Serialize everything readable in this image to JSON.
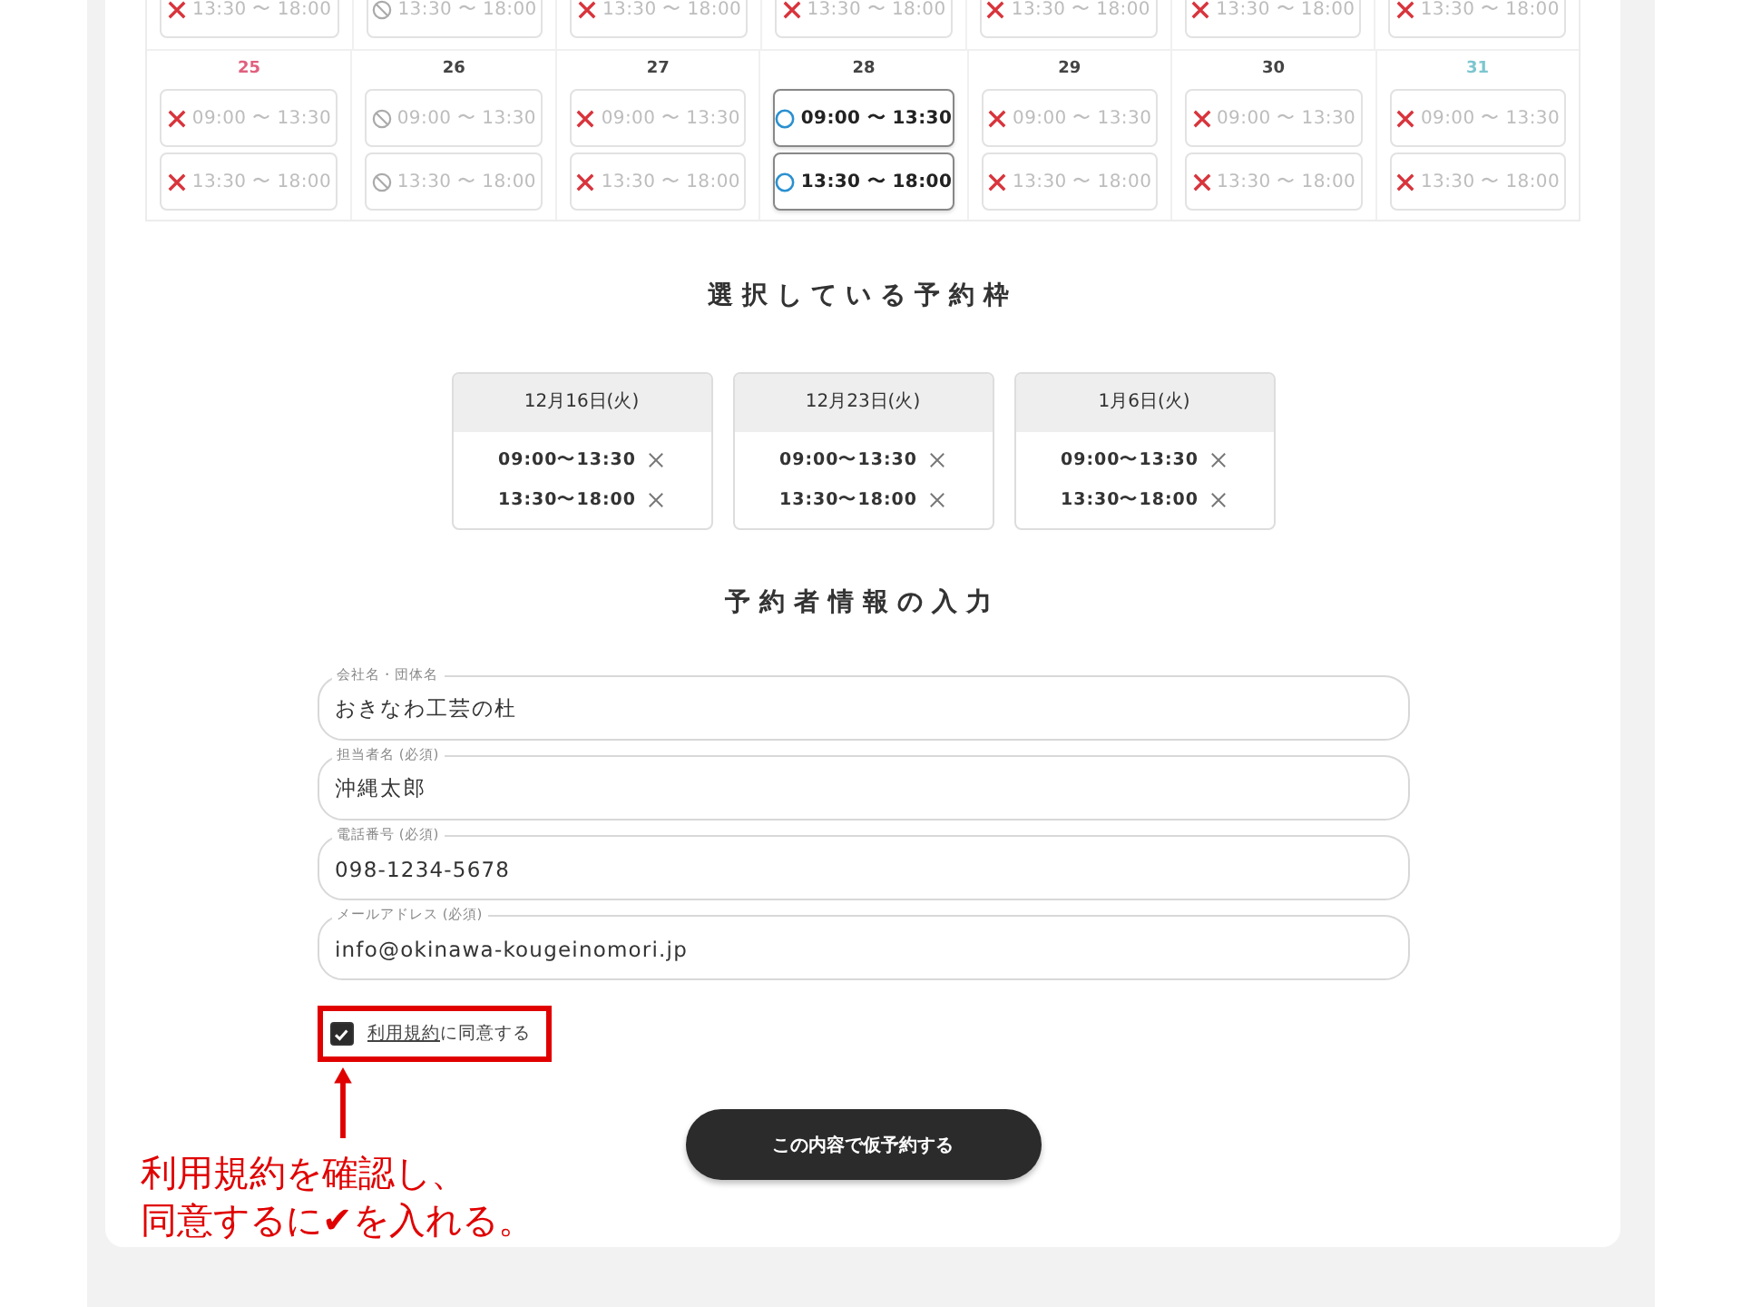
{
  "calendar": {
    "weeks": [
      {
        "days": [
          {
            "slots": [
              {
                "time": "13:30 〜 18:00",
                "kind": "full"
              }
            ]
          },
          {
            "slots": [
              {
                "time": "13:30 〜 18:00",
                "kind": "closed"
              }
            ]
          },
          {
            "slots": [
              {
                "time": "13:30 〜 18:00",
                "kind": "full"
              }
            ]
          },
          {
            "slots": [
              {
                "time": "13:30 〜 18:00",
                "kind": "full"
              }
            ]
          },
          {
            "slots": [
              {
                "time": "13:30 〜 18:00",
                "kind": "full"
              }
            ]
          },
          {
            "slots": [
              {
                "time": "13:30 〜 18:00",
                "kind": "full"
              }
            ]
          },
          {
            "slots": [
              {
                "time": "13:30 〜 18:00",
                "kind": "full"
              }
            ]
          }
        ]
      },
      {
        "days": [
          {
            "date": "25",
            "color": "#e0607e",
            "slots": [
              {
                "time": "09:00 〜 13:30",
                "kind": "full"
              },
              {
                "time": "13:30 〜 18:00",
                "kind": "full"
              }
            ]
          },
          {
            "date": "26",
            "color": "#444444",
            "slots": [
              {
                "time": "09:00 〜 13:30",
                "kind": "closed"
              },
              {
                "time": "13:30 〜 18:00",
                "kind": "closed"
              }
            ]
          },
          {
            "date": "27",
            "color": "#444444",
            "slots": [
              {
                "time": "09:00 〜 13:30",
                "kind": "full"
              },
              {
                "time": "13:30 〜 18:00",
                "kind": "full"
              }
            ]
          },
          {
            "date": "28",
            "color": "#444444",
            "slots": [
              {
                "time": "09:00 〜 13:30",
                "kind": "available"
              },
              {
                "time": "13:30 〜 18:00",
                "kind": "available"
              }
            ]
          },
          {
            "date": "29",
            "color": "#444444",
            "slots": [
              {
                "time": "09:00 〜 13:30",
                "kind": "full"
              },
              {
                "time": "13:30 〜 18:00",
                "kind": "full"
              }
            ]
          },
          {
            "date": "30",
            "color": "#444444",
            "slots": [
              {
                "time": "09:00 〜 13:30",
                "kind": "full"
              },
              {
                "time": "13:30 〜 18:00",
                "kind": "full"
              }
            ]
          },
          {
            "date": "31",
            "color": "#7cc6cf",
            "slots": [
              {
                "time": "09:00 〜 13:30",
                "kind": "full"
              },
              {
                "time": "13:30 〜 18:00",
                "kind": "full"
              }
            ]
          }
        ]
      }
    ]
  },
  "selected": {
    "heading": "選択している予約枠",
    "items": [
      {
        "date": "12月16日(火)",
        "times": [
          "09:00〜13:30",
          "13:30〜18:00"
        ]
      },
      {
        "date": "12月23日(火)",
        "times": [
          "09:00〜13:30",
          "13:30〜18:00"
        ]
      },
      {
        "date": "1月6日(火)",
        "times": [
          "09:00〜13:30",
          "13:30〜18:00"
        ]
      }
    ]
  },
  "form": {
    "heading": "予約者情報の入力",
    "fields": [
      {
        "label": "会社名・団体名",
        "value": "おきなわ工芸の杜"
      },
      {
        "label": "担当者名 (必須)",
        "value": "沖縄太郎"
      },
      {
        "label": "電話番号 (必須)",
        "value": "098-1234-5678"
      },
      {
        "label": "メールアドレス (必須)",
        "value": "info@okinawa-kougeinomori.jp"
      }
    ],
    "agree": {
      "checked": true,
      "link": "利用規約",
      "text": "に同意する"
    },
    "submit": "この内容で仮予約する"
  },
  "annotation": {
    "lines": [
      "利用規約を確認し、",
      "同意するに✔を入れる。"
    ]
  }
}
